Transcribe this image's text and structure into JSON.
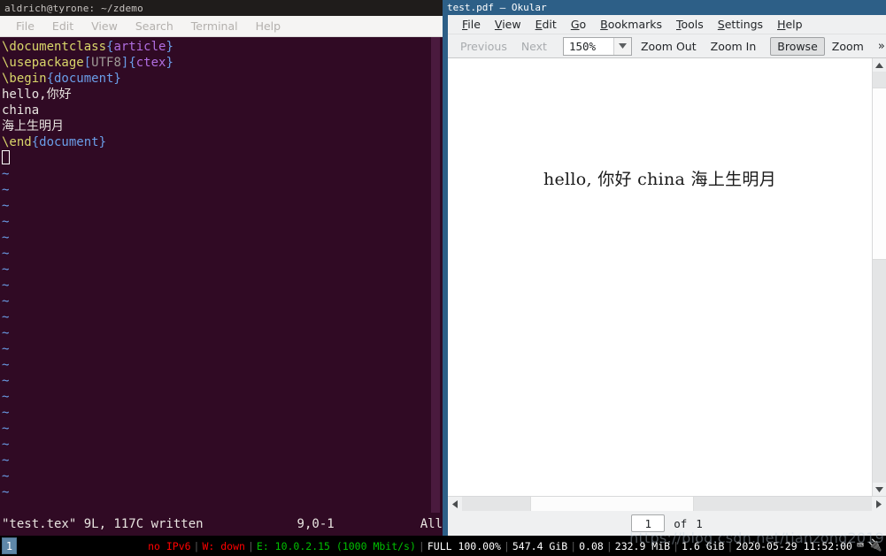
{
  "terminal": {
    "title": "aldrich@tyrone: ~/zdemo",
    "menu": [
      "File",
      "Edit",
      "View",
      "Search",
      "Terminal",
      "Help"
    ],
    "lines": [
      {
        "segments": [
          {
            "text": "\\documentclass",
            "color": "yellow"
          },
          {
            "text": "{",
            "color": "blue"
          },
          {
            "text": "article",
            "color": "purple"
          },
          {
            "text": "}",
            "color": "blue"
          }
        ]
      },
      {
        "segments": [
          {
            "text": "\\usepackage",
            "color": "yellow"
          },
          {
            "text": "[",
            "color": "blue"
          },
          {
            "text": "UTF8",
            "color": "grey"
          },
          {
            "text": "]",
            "color": "blue"
          },
          {
            "text": "{",
            "color": "blue"
          },
          {
            "text": "ctex",
            "color": "purple"
          },
          {
            "text": "}",
            "color": "blue"
          }
        ]
      },
      {
        "segments": [
          {
            "text": "\\begin",
            "color": "yellow"
          },
          {
            "text": "{document}",
            "color": "blue"
          }
        ]
      },
      {
        "segments": [
          {
            "text": "hello,你好",
            "color": "white"
          }
        ]
      },
      {
        "segments": [
          {
            "text": "china",
            "color": "white"
          }
        ]
      },
      {
        "segments": [
          {
            "text": "海上生明月",
            "color": "white"
          }
        ]
      },
      {
        "segments": [
          {
            "text": "\\end",
            "color": "yellow"
          },
          {
            "text": "{document}",
            "color": "blue"
          }
        ]
      }
    ],
    "tilde_count": 21,
    "tilde_char": "~",
    "status": {
      "file_info": "\"test.tex\" 9L, 117C written",
      "position": "9,0-1",
      "scroll": "All"
    }
  },
  "okular": {
    "title": "test.pdf  — Okular",
    "menu": [
      {
        "label": "File",
        "accel": "F"
      },
      {
        "label": "View",
        "accel": "V"
      },
      {
        "label": "Edit",
        "accel": "E"
      },
      {
        "label": "Go",
        "accel": "G"
      },
      {
        "label": "Bookmarks",
        "accel": "B"
      },
      {
        "label": "Tools",
        "accel": "T"
      },
      {
        "label": "Settings",
        "accel": "S"
      },
      {
        "label": "Help",
        "accel": "H"
      }
    ],
    "toolbar": {
      "previous_label": "Previous",
      "next_label": "Next",
      "zoom_value": "150%",
      "zoom_out_label": "Zoom Out",
      "zoom_in_label": "Zoom In",
      "browse_label": "Browse",
      "zoom_label": "Zoom",
      "overflow_label": "»"
    },
    "document": {
      "text": "hello, 你好 china 海上生明月"
    },
    "statusbar": {
      "page_value": "1",
      "of_label": "of",
      "total_pages": "1"
    },
    "scroll": {
      "up_arrow": "▲",
      "down_arrow": "▼",
      "left_arrow": "◀",
      "right_arrow": "▶"
    }
  },
  "taskbar": {
    "workspace": "1",
    "status_items": [
      {
        "text": "no IPv6",
        "color": "red"
      },
      {
        "text": "|",
        "color": "sep"
      },
      {
        "text": "W: down",
        "color": "red"
      },
      {
        "text": "|",
        "color": "sep"
      },
      {
        "text": "E: 10.0.2.15 (1000 Mbit/s)",
        "color": "green"
      },
      {
        "text": "|",
        "color": "sep"
      },
      {
        "text": "FULL 100.00%",
        "color": "white"
      },
      {
        "text": "|",
        "color": "sep"
      },
      {
        "text": "547.4 GiB",
        "color": "white"
      },
      {
        "text": "|",
        "color": "sep"
      },
      {
        "text": "0.08",
        "color": "white"
      },
      {
        "text": "|",
        "color": "sep"
      },
      {
        "text": "232.9 MiB",
        "color": "white"
      },
      {
        "text": "|",
        "color": "sep"
      },
      {
        "text": "1.6 GiB",
        "color": "white"
      },
      {
        "text": "|",
        "color": "sep"
      },
      {
        "text": "2020-05-29 11:52:00",
        "color": "white"
      }
    ],
    "tray": [
      "⌨",
      "🔌"
    ]
  },
  "watermark": "https://blog.csdn.net/tianzong2019"
}
